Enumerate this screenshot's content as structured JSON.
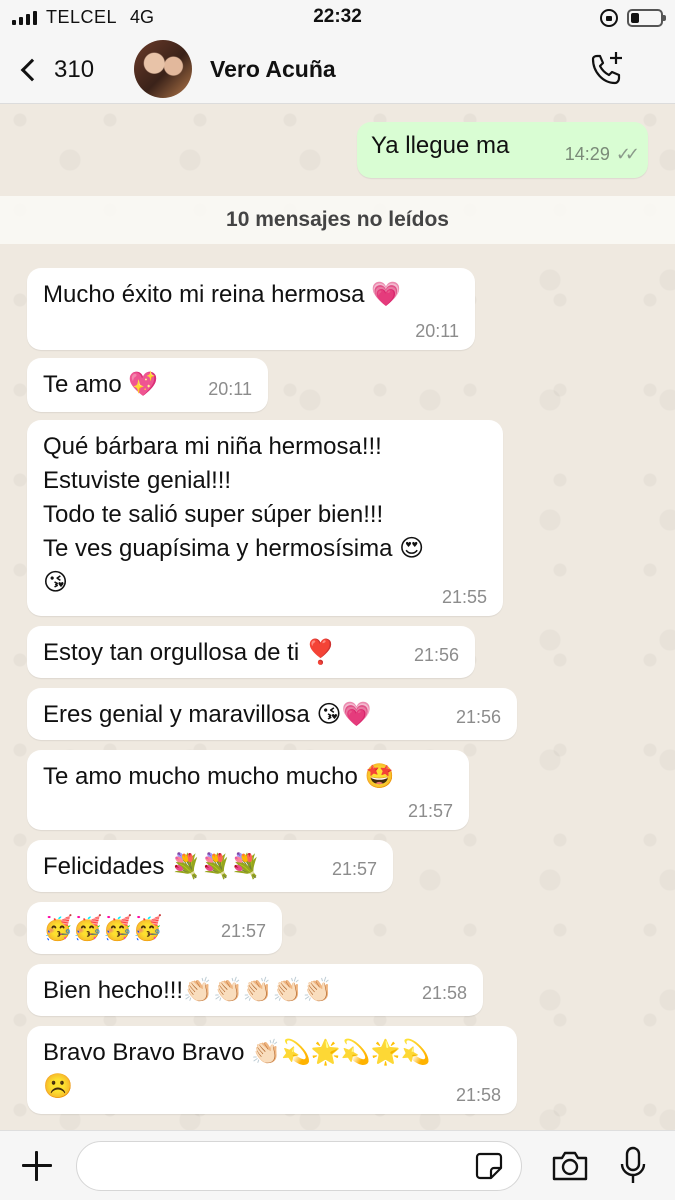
{
  "status_bar": {
    "carrier": "TELCEL",
    "network": "4G",
    "time": "22:32"
  },
  "header": {
    "back_count": "310",
    "contact_name": "Vero Acuña"
  },
  "outgoing": {
    "text": "Ya llegue ma",
    "time": "14:29",
    "status": "read"
  },
  "unread_banner": "10 mensajes no leídos",
  "messages": [
    {
      "text": "Mucho éxito mi reina hermosa 💗",
      "time": "20:11"
    },
    {
      "text": "Te amo 💖",
      "time": "20:11"
    },
    {
      "text": "Qué bárbara mi niña hermosa!!!\nEstuviste genial!!!\nTodo te salió super súper bien!!!\nTe ves guapísima y hermosísima 😍\n😘",
      "time": "21:55"
    },
    {
      "text": "Estoy tan orgullosa de ti ❣️",
      "time": "21:56"
    },
    {
      "text": "Eres genial y maravillosa 😘💗",
      "time": "21:56"
    },
    {
      "text": "Te amo mucho mucho mucho 🤩",
      "time": "21:57"
    },
    {
      "text": "Felicidades 💐💐💐",
      "time": "21:57"
    },
    {
      "text": "🥳🥳🥳🥳",
      "time": "21:57"
    },
    {
      "text": "Bien hecho!!!👏🏻👏🏻👏🏻👏🏻👏🏻",
      "time": "21:58"
    },
    {
      "text": "Bravo Bravo Bravo 👏🏻💫🌟💫🌟💫\n☹️",
      "time": "21:58"
    }
  ],
  "input": {
    "placeholder": ""
  },
  "icons": {
    "back": "chevron-left-icon",
    "call": "phone-plus-icon",
    "attach": "plus-icon",
    "sticker": "sticker-icon",
    "camera": "camera-icon",
    "mic": "microphone-icon"
  },
  "colors": {
    "outgoing_bubble": "#d9fdd3",
    "incoming_bubble": "#ffffff",
    "chat_background": "#efe9e0"
  }
}
